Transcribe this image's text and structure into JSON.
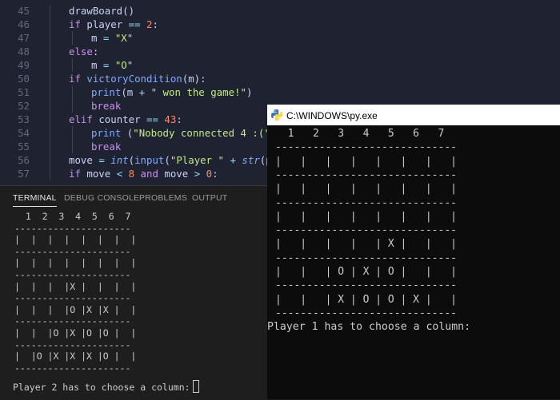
{
  "editor": {
    "lines": [
      {
        "n": "45",
        "segs": [
          [
            "var",
            "drawBoard()"
          ]
        ],
        "indent": 1
      },
      {
        "n": "46",
        "segs": [
          [
            "kw",
            "if "
          ],
          [
            "var",
            "player "
          ],
          [
            "op",
            "== "
          ],
          [
            "num",
            "2"
          ],
          [
            "var",
            ":"
          ]
        ],
        "indent": 1
      },
      {
        "n": "47",
        "segs": [
          [
            "var",
            "m "
          ],
          [
            "op",
            "= "
          ],
          [
            "str",
            "\"X\""
          ]
        ],
        "indent": 2
      },
      {
        "n": "48",
        "segs": [
          [
            "kw",
            "else"
          ],
          [
            "var",
            ":"
          ]
        ],
        "indent": 1
      },
      {
        "n": "49",
        "segs": [
          [
            "var",
            "m "
          ],
          [
            "op",
            "= "
          ],
          [
            "str",
            "\"O\""
          ]
        ],
        "indent": 2
      },
      {
        "n": "50",
        "segs": [
          [
            "kw",
            "if "
          ],
          [
            "fn",
            "victoryCondition"
          ],
          [
            "var",
            "(m):"
          ]
        ],
        "indent": 1
      },
      {
        "n": "51",
        "segs": [
          [
            "fn",
            "print"
          ],
          [
            "var",
            "(m "
          ],
          [
            "op",
            "+ "
          ],
          [
            "str",
            "\" won the game!\""
          ],
          [
            "var",
            ")"
          ]
        ],
        "indent": 2
      },
      {
        "n": "52",
        "segs": [
          [
            "kw",
            "break"
          ]
        ],
        "indent": 2
      },
      {
        "n": "53",
        "segs": [
          [
            "kw",
            "elif "
          ],
          [
            "var",
            "counter "
          ],
          [
            "op",
            "== "
          ],
          [
            "num",
            "43"
          ],
          [
            "var",
            ":"
          ]
        ],
        "indent": 1
      },
      {
        "n": "54",
        "segs": [
          [
            "fn",
            "print "
          ],
          [
            "var",
            "("
          ],
          [
            "str",
            "\"Nobody connected 4 :(\""
          ],
          [
            "var",
            ")"
          ]
        ],
        "indent": 2
      },
      {
        "n": "55",
        "segs": [
          [
            "kw",
            "break"
          ]
        ],
        "indent": 2
      },
      {
        "n": "56",
        "segs": [
          [
            "var",
            "move "
          ],
          [
            "op",
            "= "
          ],
          [
            "it",
            "int"
          ],
          [
            "var",
            "("
          ],
          [
            "fn",
            "input"
          ],
          [
            "var",
            "("
          ],
          [
            "str",
            "\"Player \" "
          ],
          [
            "op",
            "+ "
          ],
          [
            "it",
            "str"
          ],
          [
            "var",
            "(pla"
          ]
        ],
        "indent": 1
      },
      {
        "n": "57",
        "segs": [
          [
            "kw",
            "if "
          ],
          [
            "var",
            "move "
          ],
          [
            "op",
            "< "
          ],
          [
            "num",
            "8 "
          ],
          [
            "kw",
            "and "
          ],
          [
            "var",
            "move "
          ],
          [
            "op",
            "> "
          ],
          [
            "num",
            "0"
          ],
          [
            "var",
            ":"
          ]
        ],
        "indent": 1
      }
    ]
  },
  "panel": {
    "tabs": [
      "TERMINAL",
      "DEBUG CONSOLE",
      "PROBLEMS",
      "OUTPUT"
    ],
    "active_tab": "TERMINAL"
  },
  "terminal": {
    "lines": [
      "  1  2  3  4  5  6  7",
      "---------------------",
      "|  |  |  |  |  |  |  |",
      "---------------------",
      "|  |  |  |  |  |  |  |",
      "---------------------",
      "|  |  |  |X |  |  |  |",
      "---------------------",
      "|  |  |  |O |X |X |  |",
      "---------------------",
      "|  |  |O |X |O |O |  |",
      "---------------------",
      "|  |O |X |X |X |O |  |",
      "---------------------"
    ],
    "prompt": "Player 2 has to choose a column:"
  },
  "console_window": {
    "title": "C:\\WINDOWS\\py.exe",
    "lines": [
      "  1   2   3   4   5   6   7",
      "-----------------------------",
      "|   |   |   |   |   |   |   |",
      "-----------------------------",
      "|   |   |   |   |   |   |   |",
      "-----------------------------",
      "|   |   |   |   |   |   |   |",
      "-----------------------------",
      "|   |   |   |   | X |   |   |",
      "-----------------------------",
      "|   |   | O | X | O |   |   |",
      "-----------------------------",
      "|   |   | X | O | O | X |   |",
      "-----------------------------"
    ],
    "prompt": "Player 1 has to choose a column:"
  }
}
